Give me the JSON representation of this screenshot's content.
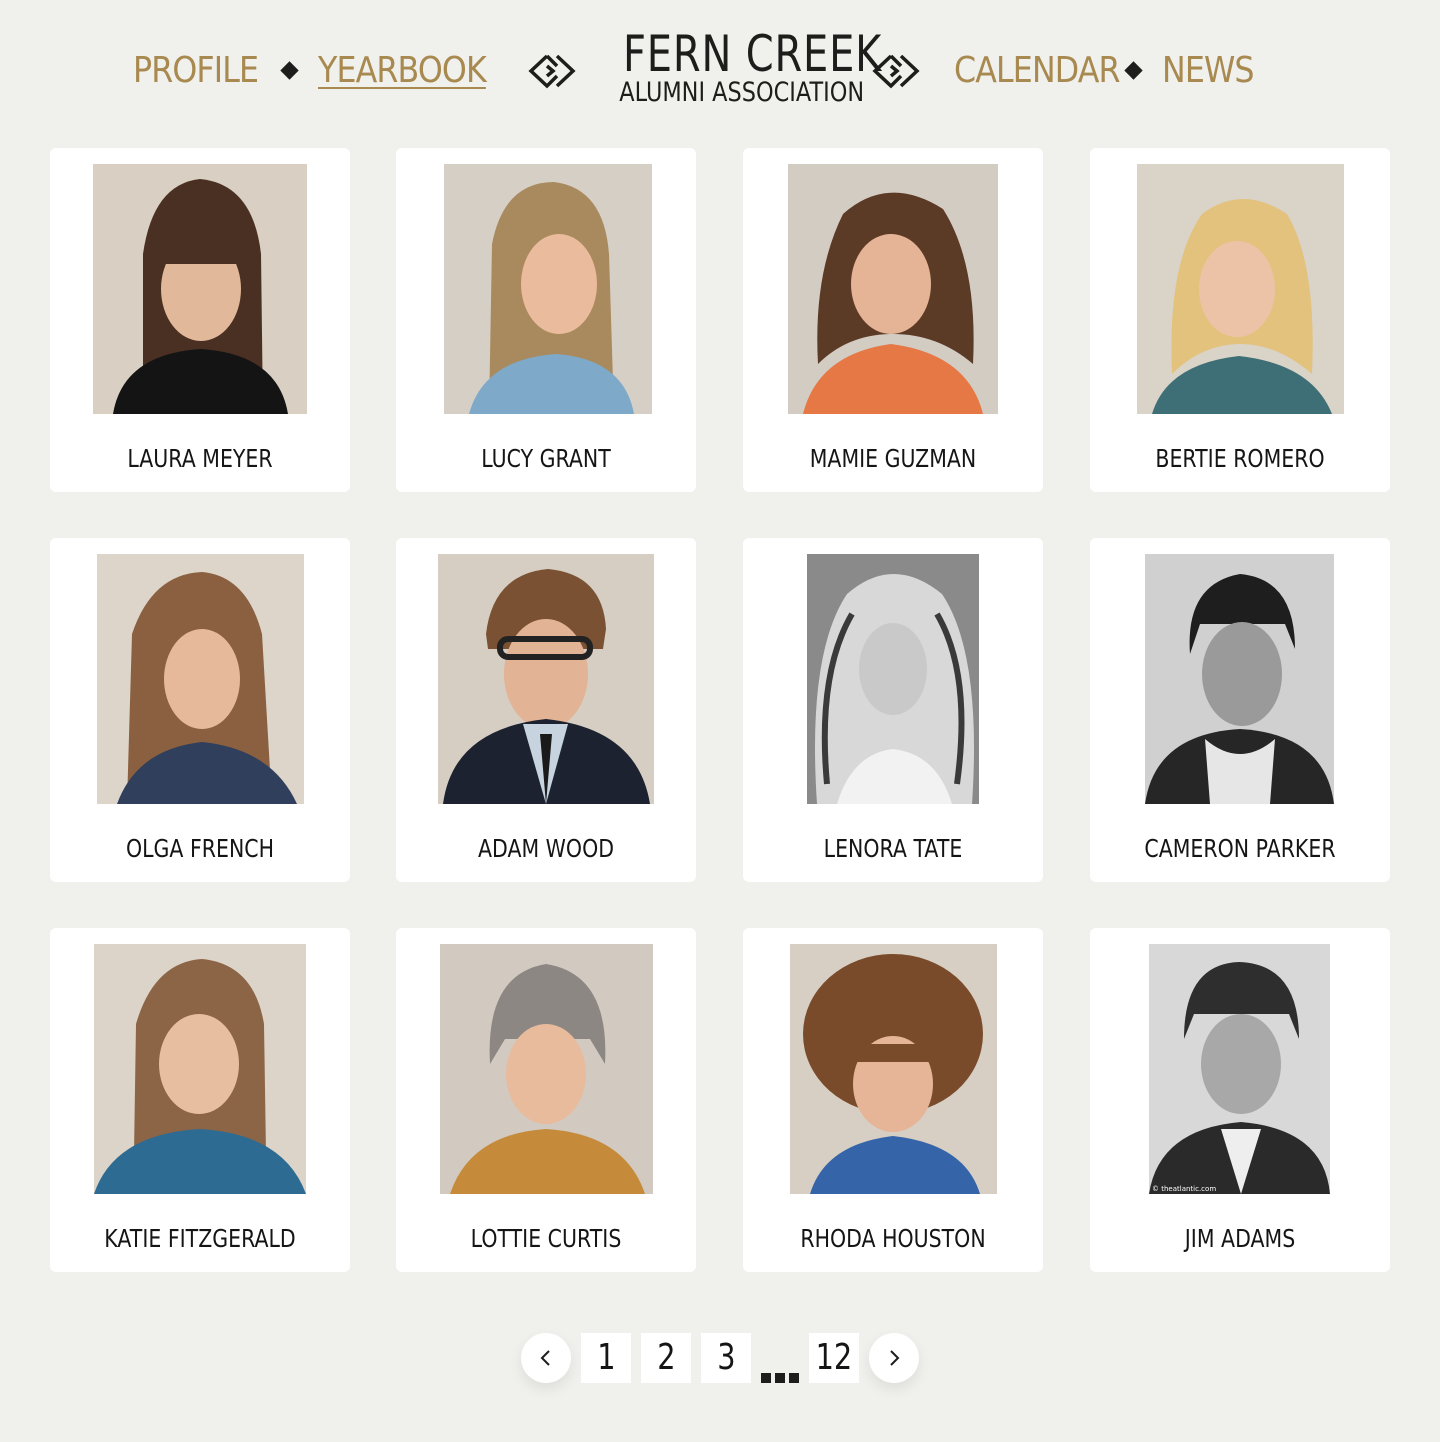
{
  "nav": {
    "left": [
      {
        "label": "Profile",
        "active": false
      },
      {
        "label": "Yearbook",
        "active": true
      }
    ],
    "right": [
      {
        "label": "Calendar",
        "active": false
      },
      {
        "label": "News",
        "active": false
      }
    ]
  },
  "logo": {
    "title": "Fern Creek",
    "subtitle": "Alumni Association"
  },
  "students": [
    {
      "name": "Laura Meyer",
      "photo": "yearbook-portrait"
    },
    {
      "name": "Lucy Grant",
      "photo": "yearbook-portrait"
    },
    {
      "name": "Mamie Guzman",
      "photo": "yearbook-portrait"
    },
    {
      "name": "Bertie Romero",
      "photo": "yearbook-portrait"
    },
    {
      "name": "Olga French",
      "photo": "yearbook-portrait"
    },
    {
      "name": "Adam Wood",
      "photo": "yearbook-portrait"
    },
    {
      "name": "Lenora Tate",
      "photo": "yearbook-portrait"
    },
    {
      "name": "Cameron Parker",
      "photo": "yearbook-portrait"
    },
    {
      "name": "Katie Fitzgerald",
      "photo": "yearbook-portrait"
    },
    {
      "name": "Lottie Curtis",
      "photo": "yearbook-portrait"
    },
    {
      "name": "Rhoda Houston",
      "photo": "yearbook-portrait"
    },
    {
      "name": "Jim Adams",
      "photo": "yearbook-portrait",
      "credit": "© theatlantic.com"
    }
  ],
  "pagination": {
    "prev_icon": "chevron-left-icon",
    "next_icon": "chevron-right-icon",
    "pages": [
      "1",
      "2",
      "3"
    ],
    "last_page": "12"
  },
  "colors": {
    "background": "#f0f0ec",
    "accent_gold": "#a8894f",
    "text_dark": "#1d1d1b",
    "card": "#ffffff"
  }
}
